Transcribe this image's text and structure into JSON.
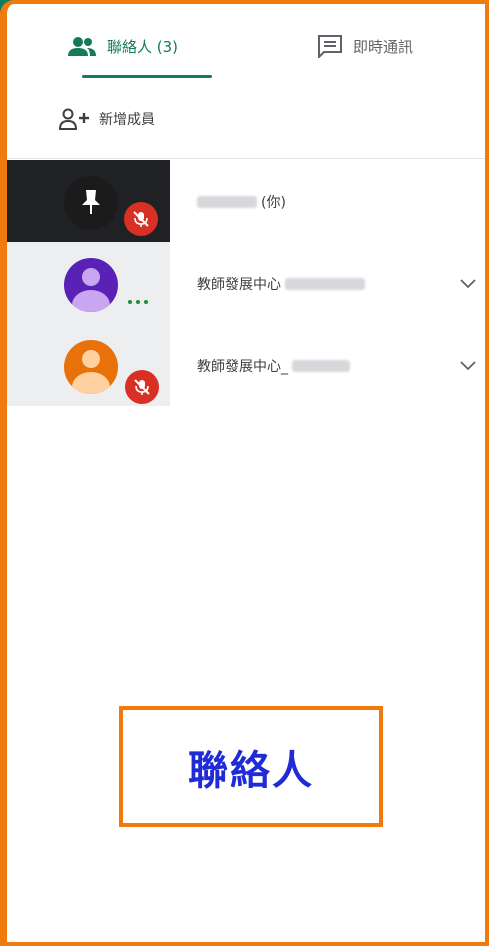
{
  "tabs": {
    "contacts": {
      "label": "聯絡人 (3)"
    },
    "chat": {
      "label": "即時通訊"
    }
  },
  "toolbar": {
    "add_member_label": "新增成員"
  },
  "participants": [
    {
      "name_suffix": "(你)",
      "avatar_icon": "pin-icon",
      "status_icon": "mic-off-icon"
    },
    {
      "name_prefix": "教師發展中心",
      "avatar_icon": "person-icon",
      "status_icon": "speaking-dots-icon",
      "expand_icon": "chevron-down-icon"
    },
    {
      "name_prefix": "教師發展中心_",
      "avatar_icon": "person-icon",
      "status_icon": "mic-off-icon",
      "expand_icon": "chevron-down-icon"
    }
  ],
  "annotation": {
    "text": "聯絡人"
  },
  "colors": {
    "accent": "#137a5c",
    "highlight_border": "#f07a0e",
    "annotation_text": "#1f2bd6",
    "mic_off": "#d93025"
  }
}
